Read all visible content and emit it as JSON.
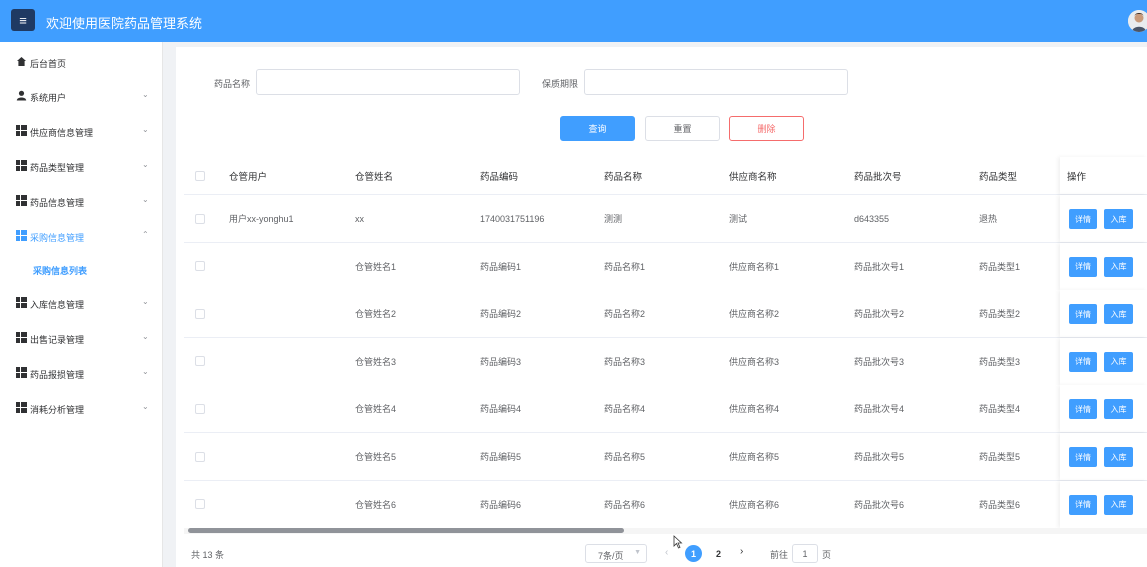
{
  "header": {
    "title": "欢迎使用医院药品管理系统",
    "menu_icon": "≡"
  },
  "sidebar": {
    "items": [
      {
        "label": "后台首页",
        "icon": "home-icon",
        "expandable": false
      },
      {
        "label": "系统用户",
        "icon": "user-icon",
        "expandable": true
      },
      {
        "label": "供应商信息管理",
        "icon": "grid-icon",
        "expandable": true
      },
      {
        "label": "药品类型管理",
        "icon": "grid-icon",
        "expandable": true
      },
      {
        "label": "药品信息管理",
        "icon": "grid-icon",
        "expandable": true
      },
      {
        "label": "采购信息管理",
        "icon": "grid-icon",
        "expandable": true,
        "active": true
      },
      {
        "label": "入库信息管理",
        "icon": "grid-icon",
        "expandable": true
      },
      {
        "label": "出售记录管理",
        "icon": "grid-icon",
        "expandable": true
      },
      {
        "label": "药品报损管理",
        "icon": "grid-icon",
        "expandable": true
      },
      {
        "label": "消耗分析管理",
        "icon": "grid-icon",
        "expandable": true
      }
    ],
    "sub_item": "采购信息列表",
    "arrow_down": "⌄",
    "arrow_up": "⌃"
  },
  "search": {
    "name_label": "药品名称",
    "name_value": "",
    "expiry_label": "保质期限",
    "expiry_value": "",
    "query_label": "查询",
    "reset_label": "重置",
    "delete_label": "删除"
  },
  "table": {
    "columns": [
      "仓管用户",
      "仓管姓名",
      "药品编码",
      "药品名称",
      "供应商名称",
      "药品批次号",
      "药品类型",
      "操作"
    ],
    "rows": [
      [
        "用户xx-yonghu1",
        "xx",
        "1740031751196",
        "测测",
        "测试",
        "d643355",
        "退热"
      ],
      [
        "",
        "仓管姓名1",
        "药品编码1",
        "药品名称1",
        "供应商名称1",
        "药品批次号1",
        "药品类型1"
      ],
      [
        "",
        "仓管姓名2",
        "药品编码2",
        "药品名称2",
        "供应商名称2",
        "药品批次号2",
        "药品类型2"
      ],
      [
        "",
        "仓管姓名3",
        "药品编码3",
        "药品名称3",
        "供应商名称3",
        "药品批次号3",
        "药品类型3"
      ],
      [
        "",
        "仓管姓名4",
        "药品编码4",
        "药品名称4",
        "供应商名称4",
        "药品批次号4",
        "药品类型4"
      ],
      [
        "",
        "仓管姓名5",
        "药品编码5",
        "药品名称5",
        "供应商名称5",
        "药品批次号5",
        "药品类型5"
      ],
      [
        "",
        "仓管姓名6",
        "药品编码6",
        "药品名称6",
        "供应商名称6",
        "药品批次号6",
        "药品类型6"
      ]
    ],
    "detail_label": "详情",
    "stock_label": "入库"
  },
  "pagination": {
    "total": "共 13 条",
    "page_size": "7条/页",
    "prev": "‹",
    "pages": [
      "1",
      "2"
    ],
    "current_page": "1",
    "next": "›",
    "goto_label": "前往",
    "goto_value": "1",
    "page_suffix": "页"
  },
  "colors": {
    "primary": "#409eff",
    "danger": "#f56c6c",
    "menu_button": "#1f3a63"
  }
}
